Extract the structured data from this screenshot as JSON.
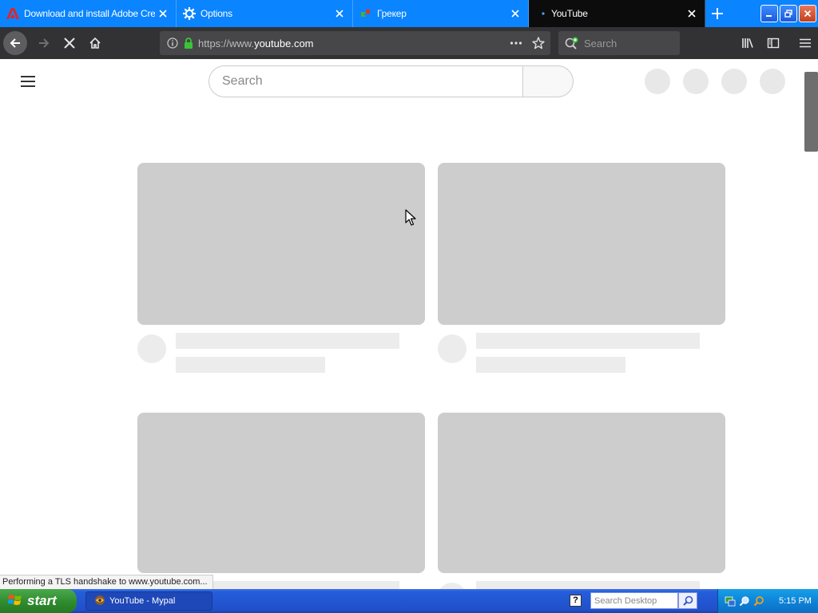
{
  "tabs": [
    {
      "label": "Download and install Adobe Creat",
      "icon": "adobe-icon",
      "active": false
    },
    {
      "label": "Options",
      "icon": "gear-icon",
      "active": false
    },
    {
      "label": "Грекер",
      "icon": "puzzle-icon",
      "active": false
    },
    {
      "label": "YouTube",
      "icon": "loading-dot-icon",
      "active": true
    }
  ],
  "navbar": {
    "url_prefix": "https://www.",
    "url_host": "youtube.com",
    "search_placeholder": "Search"
  },
  "youtube": {
    "search_placeholder": "Search"
  },
  "status_text": "Performing a TLS handshake to www.youtube.com...",
  "taskbar": {
    "start_label": "start",
    "task_label": "YouTube - Mypal",
    "help_label": "?",
    "desktop_search_placeholder": "Search Desktop",
    "clock": "5:15 PM"
  },
  "colors": {
    "tab_bar": "#0a84ff",
    "active_tab": "#0c0c0d",
    "toolbar": "#323234",
    "skeleton_thumb": "#cdcdcd",
    "skeleton_line": "#ececec",
    "taskbar": "#245ddb",
    "start_button": "#2e8b2e"
  }
}
